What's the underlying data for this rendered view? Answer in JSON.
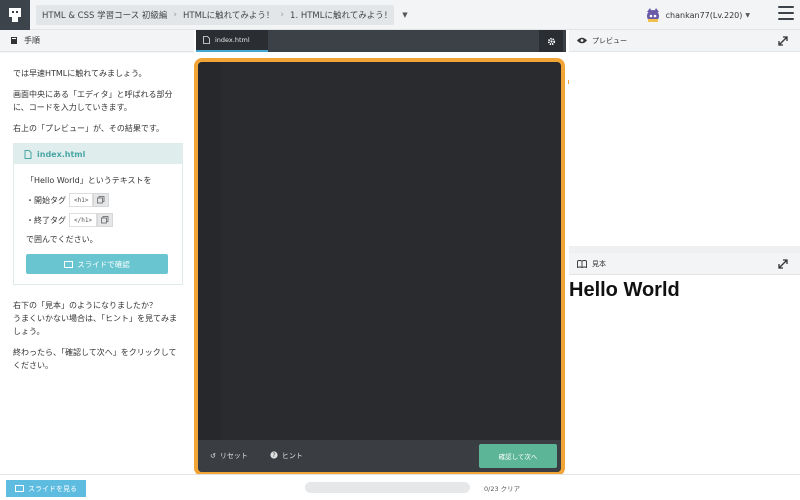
{
  "header": {
    "breadcrumbs": [
      "HTML & CSS 学習コース 初級編",
      "HTMLに触れてみよう！",
      "1. HTMLに触れてみよう！"
    ],
    "user_label": "chankan77(Lv.220)"
  },
  "left_panel": {
    "title": "手順",
    "paragraphs": [
      "では早速HTMLに触れてみましょう。",
      "画面中央にある「エディタ」と呼ばれる部分に、コードを入力していきます。",
      "右上の「プレビュー」が、その結果です。"
    ],
    "card": {
      "file_label": "index.html",
      "instruction": "「Hello World」というテキストを",
      "open_tag_label": "・開始タグ",
      "open_tag_code": "<h1>",
      "close_tag_label": "・終了タグ",
      "close_tag_code": "</h1>",
      "wrap_text": "で囲んでください。",
      "slide_button": "スライドで確認"
    },
    "paragraphs2": [
      "右下の「見本」のようになりましたか？",
      "うまくいかない場合は、「ヒント」を見てみましょう。",
      "終わったら、「確認して次へ」をクリックしてください。"
    ]
  },
  "editor": {
    "tab_label": "index.html",
    "reset_label": "リセット",
    "hint_label": "ヒント",
    "check_button": "確認して次へ"
  },
  "preview": {
    "title": "プレビュー"
  },
  "sample": {
    "title": "見本",
    "content": "Hello World"
  },
  "footer": {
    "see_slides_label": "スライドを見る",
    "progress_label": "0/23 クリア",
    "progress_fraction": 0
  },
  "colors": {
    "accent_orange": "#f0a536",
    "check_green": "#5bb596",
    "slide_blue": "#69c6d1",
    "editor_bg": "#2a2b2e"
  }
}
